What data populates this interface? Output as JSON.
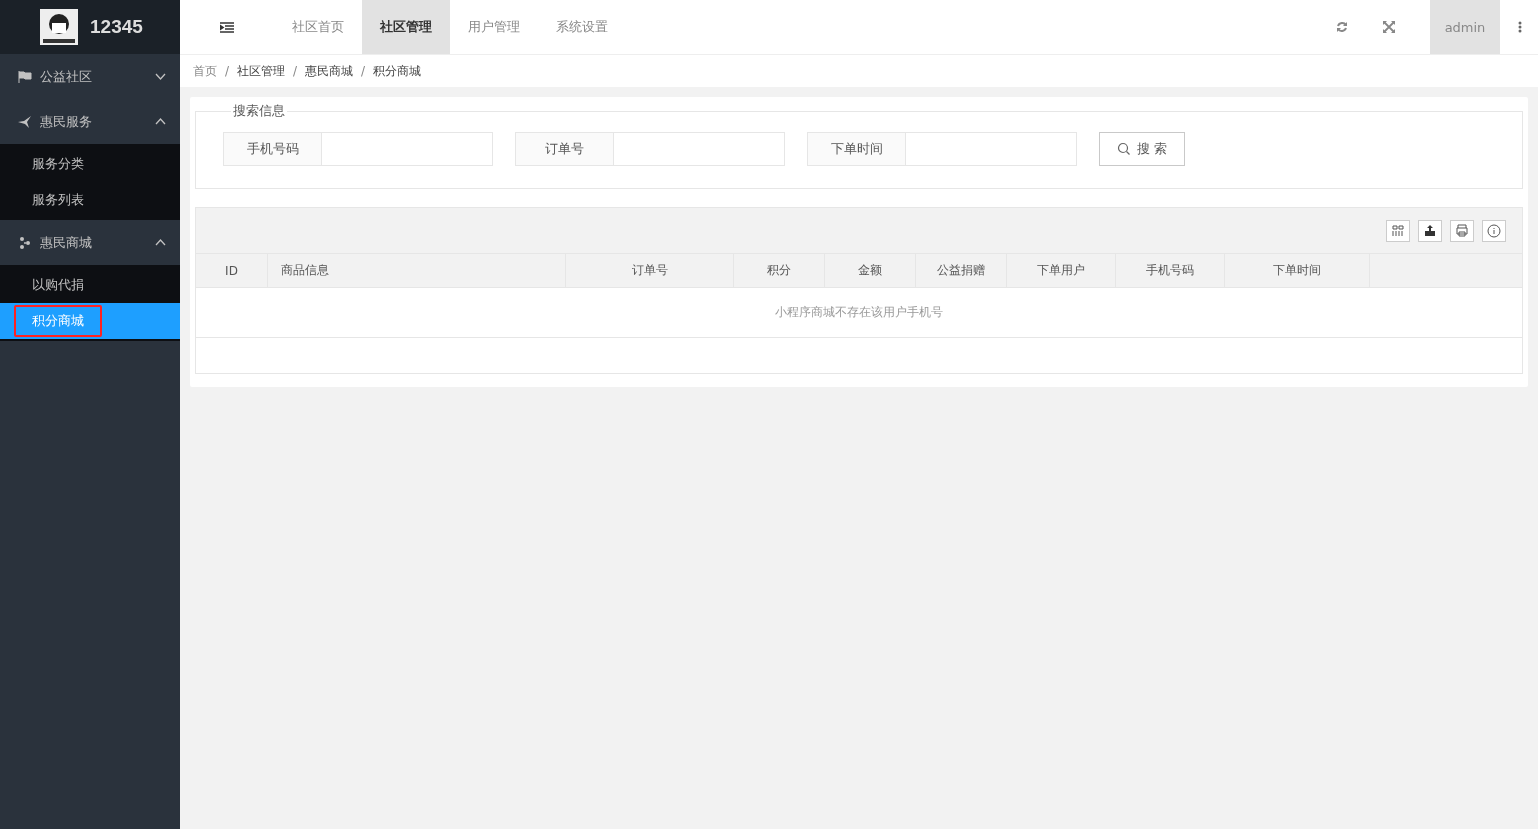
{
  "logo": {
    "title": "12345"
  },
  "topnav": [
    {
      "label": "社区首页",
      "selected": false
    },
    {
      "label": "社区管理",
      "selected": true
    },
    {
      "label": "用户管理",
      "selected": false
    },
    {
      "label": "系统设置",
      "selected": false
    }
  ],
  "user": "admin",
  "sidebar": [
    {
      "label": "公益社区",
      "expanded": false
    },
    {
      "label": "惠民服务",
      "expanded": true,
      "children": [
        {
          "label": "服务分类",
          "selected": false
        },
        {
          "label": "服务列表",
          "selected": false
        }
      ]
    },
    {
      "label": "惠民商城",
      "expanded": true,
      "children": [
        {
          "label": "以购代捐",
          "selected": false
        },
        {
          "label": "积分商城",
          "selected": true
        }
      ]
    }
  ],
  "breadcrumb": [
    {
      "kind": "link",
      "text": "首页"
    },
    {
      "kind": "separator",
      "text": "/"
    },
    {
      "kind": "link",
      "text": "社区管理"
    },
    {
      "kind": "separator",
      "text": "/"
    },
    {
      "kind": "link",
      "text": "惠民商城"
    },
    {
      "kind": "separator",
      "text": "/"
    },
    {
      "kind": "link",
      "text": "积分商城"
    }
  ],
  "search": {
    "legend": "搜索信息",
    "fields": [
      {
        "label": "手机号码"
      },
      {
        "label": "订单号"
      },
      {
        "label": "下单时间"
      }
    ],
    "button": "搜 索"
  },
  "table": {
    "columns": [
      "ID",
      "商品信息",
      "订单号",
      "积分",
      "金额",
      "公益捐赠",
      "下单用户",
      "手机号码",
      "下单时间"
    ],
    "empty": "小程序商城不存在该用户手机号"
  }
}
